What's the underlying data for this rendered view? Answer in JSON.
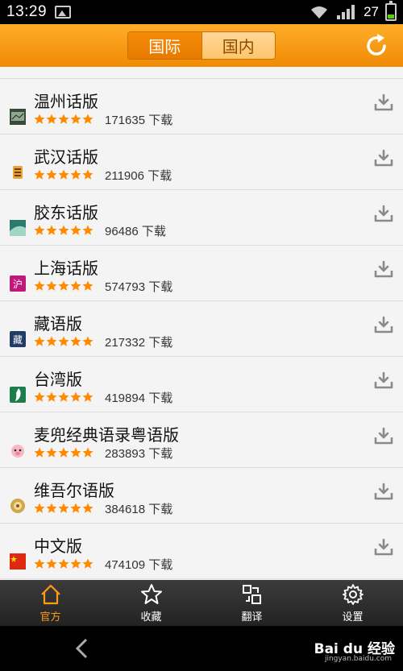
{
  "status_bar": {
    "time": "13:29",
    "battery_level": "27"
  },
  "header": {
    "tabs": [
      {
        "label": "国际"
      },
      {
        "label": "国内"
      }
    ],
    "active_tab": "国际",
    "accent_color": "#f08a05"
  },
  "items": [
    {
      "name": "温州话版",
      "downloads": "171635 下载",
      "icon": "wenzhou-app-icon",
      "rating_stars": 5
    },
    {
      "name": "武汉话版",
      "downloads": "211906 下载",
      "icon": "wuhan-app-icon",
      "rating_stars": 5
    },
    {
      "name": "胶东话版",
      "downloads": "96486 下载",
      "icon": "jiaodong-app-icon",
      "rating_stars": 5
    },
    {
      "name": "上海话版",
      "downloads": "574793 下载",
      "icon": "shanghai-app-icon",
      "rating_stars": 5
    },
    {
      "name": "藏语版",
      "downloads": "217332 下载",
      "icon": "tibetan-app-icon",
      "rating_stars": 5
    },
    {
      "name": "台湾版",
      "downloads": "419894 下载",
      "icon": "taiwan-app-icon",
      "rating_stars": 5
    },
    {
      "name": "麦兜经典语录粤语版",
      "downloads": "283893 下载",
      "icon": "mcdull-app-icon",
      "rating_stars": 5
    },
    {
      "name": "维吾尔语版",
      "downloads": "384618 下载",
      "icon": "uyghur-app-icon",
      "rating_stars": 5
    },
    {
      "name": "中文版",
      "downloads": "474109 下载",
      "icon": "chinese-flag-app-icon",
      "rating_stars": 5
    }
  ],
  "icon_texts": {
    "shanghai": "沪",
    "tibetan": "藏"
  },
  "bottom_nav": [
    {
      "label": "官方",
      "icon": "home-icon"
    },
    {
      "label": "收藏",
      "icon": "star-icon"
    },
    {
      "label": "翻译",
      "icon": "translate-icon"
    },
    {
      "label": "设置",
      "icon": "gear-icon"
    }
  ],
  "watermark": {
    "brand": "Bai du 经验",
    "url": "jingyan.baidu.com"
  }
}
